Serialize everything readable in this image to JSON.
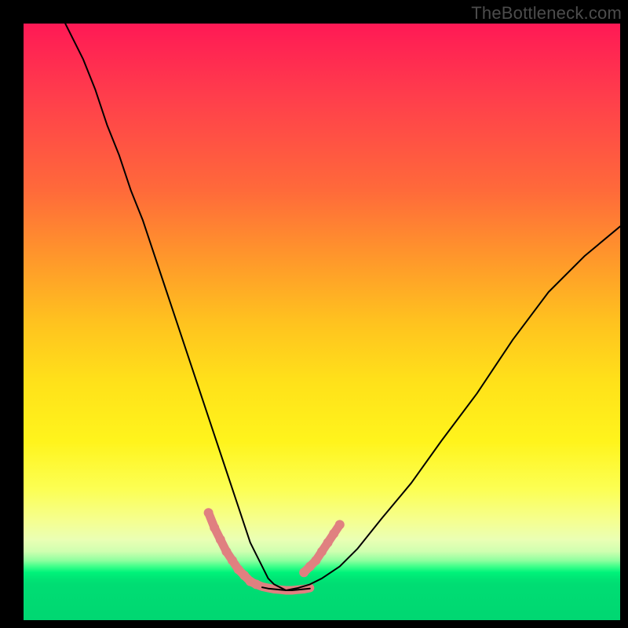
{
  "watermark": "TheBottleneck.com",
  "chart_data": {
    "type": "line",
    "title": "",
    "xlabel": "",
    "ylabel": "",
    "xlim": [
      0,
      100
    ],
    "ylim": [
      0,
      100
    ],
    "grid": false,
    "note": "Stylized bottleneck curve over a vertical red→yellow→green gradient. Axes have no numeric ticks in the source image; values below are read off relative to the 0–100 plot box.",
    "series": [
      {
        "name": "left-branch",
        "x": [
          7,
          10,
          12,
          14,
          16,
          18,
          20,
          22,
          24,
          26,
          28,
          30,
          32,
          34,
          36,
          37,
          38,
          39,
          40,
          41,
          42,
          43,
          44
        ],
        "y": [
          100,
          94,
          89,
          83,
          78,
          72,
          67,
          61,
          55,
          49,
          43,
          37,
          31,
          25,
          19,
          16,
          13,
          11,
          9,
          7,
          6,
          5.5,
          5
        ]
      },
      {
        "name": "flat-bottom",
        "x": [
          40,
          41,
          42,
          43,
          44,
          45,
          46,
          47,
          48
        ],
        "y": [
          5.5,
          5.3,
          5.2,
          5.1,
          5.0,
          5.0,
          5.1,
          5.2,
          5.3
        ]
      },
      {
        "name": "right-branch",
        "x": [
          44,
          46,
          48,
          50,
          53,
          56,
          60,
          65,
          70,
          76,
          82,
          88,
          94,
          100
        ],
        "y": [
          5,
          5.4,
          6,
          7,
          9,
          12,
          17,
          23,
          30,
          38,
          47,
          55,
          61,
          66
        ]
      }
    ],
    "highlighted_segments": [
      {
        "name": "left-highlight",
        "x": [
          31,
          32,
          33,
          34,
          35,
          36,
          37,
          38,
          39
        ],
        "y": [
          18,
          15.5,
          13.5,
          11.5,
          10,
          8.5,
          7.5,
          6.5,
          6
        ]
      },
      {
        "name": "bottom-highlight",
        "x": [
          39,
          40,
          41,
          42,
          43,
          44,
          45,
          46,
          47,
          48
        ],
        "y": [
          6,
          5.6,
          5.4,
          5.2,
          5.1,
          5.0,
          5.0,
          5.1,
          5.2,
          5.4
        ]
      },
      {
        "name": "right-highlight",
        "x": [
          47,
          48,
          49,
          50,
          51,
          52,
          53
        ],
        "y": [
          8,
          9,
          10,
          11.5,
          13,
          14.5,
          16
        ]
      }
    ],
    "gradient_stops": [
      {
        "pos": 0.0,
        "color": "#ff1955"
      },
      {
        "pos": 0.5,
        "color": "#ffe11a"
      },
      {
        "pos": 0.9,
        "color": "#3fff8a"
      },
      {
        "pos": 1.0,
        "color": "#00d772"
      }
    ]
  }
}
